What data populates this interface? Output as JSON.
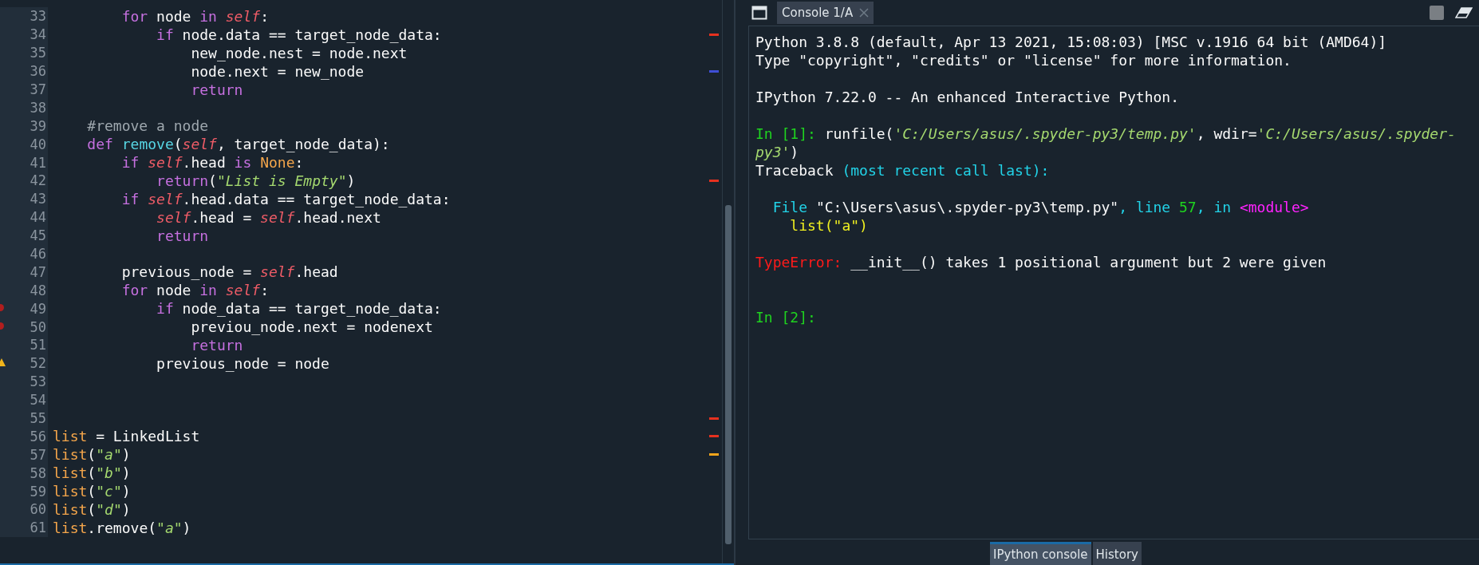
{
  "editor": {
    "lines": [
      {
        "number": "33",
        "overview_error": false,
        "overview_info": false,
        "overview_warning": false,
        "gutter_error": false,
        "gutter_warning": false,
        "tokens": [
          {
            "kind": "keyword",
            "text": "        for"
          },
          {
            "kind": "plain",
            "text": " node "
          },
          {
            "kind": "keyword",
            "text": "in "
          },
          {
            "kind": "self",
            "text": "self"
          },
          {
            "kind": "plain",
            "text": ":"
          }
        ]
      },
      {
        "number": "34",
        "overview_error": true,
        "overview_info": false,
        "overview_warning": false,
        "gutter_error": false,
        "gutter_warning": false,
        "tokens": [
          {
            "kind": "keyword",
            "text": "            if"
          },
          {
            "kind": "plain",
            "text": " node.data == target_node_data:"
          }
        ]
      },
      {
        "number": "35",
        "overview_error": false,
        "overview_info": false,
        "overview_warning": false,
        "gutter_error": false,
        "gutter_warning": false,
        "tokens": [
          {
            "kind": "plain",
            "text": "                new_node.nest = node.next"
          }
        ]
      },
      {
        "number": "36",
        "overview_error": false,
        "overview_info": true,
        "overview_warning": false,
        "gutter_error": false,
        "gutter_warning": false,
        "tokens": [
          {
            "kind": "plain",
            "text": "                node.next = new_node"
          }
        ]
      },
      {
        "number": "37",
        "overview_error": false,
        "overview_info": false,
        "overview_warning": false,
        "gutter_error": false,
        "gutter_warning": false,
        "tokens": [
          {
            "kind": "keyword",
            "text": "                return"
          }
        ]
      },
      {
        "number": "38",
        "overview_error": false,
        "overview_info": false,
        "overview_warning": false,
        "gutter_error": false,
        "gutter_warning": false
      },
      {
        "number": "39",
        "overview_error": false,
        "overview_info": false,
        "overview_warning": false,
        "gutter_error": false,
        "gutter_warning": false,
        "tokens": [
          {
            "kind": "comment",
            "text": "    #remove a node"
          }
        ]
      },
      {
        "number": "40",
        "overview_error": false,
        "overview_info": false,
        "overview_warning": false,
        "gutter_error": false,
        "gutter_warning": false,
        "tokens": [
          {
            "kind": "keyword",
            "text": "    def "
          },
          {
            "kind": "function",
            "text": "remove"
          },
          {
            "kind": "plain",
            "text": "("
          },
          {
            "kind": "self",
            "text": "self"
          },
          {
            "kind": "plain",
            "text": ", target_node_data):"
          }
        ]
      },
      {
        "number": "41",
        "overview_error": false,
        "overview_info": false,
        "overview_warning": false,
        "gutter_error": false,
        "gutter_warning": false,
        "tokens": [
          {
            "kind": "keyword",
            "text": "        if "
          },
          {
            "kind": "self",
            "text": "self"
          },
          {
            "kind": "plain",
            "text": ".head "
          },
          {
            "kind": "keyword",
            "text": "is "
          },
          {
            "kind": "builtin",
            "text": "None"
          },
          {
            "kind": "plain",
            "text": ":"
          }
        ]
      },
      {
        "number": "42",
        "overview_error": true,
        "overview_info": false,
        "overview_warning": false,
        "gutter_error": false,
        "gutter_warning": false,
        "tokens": [
          {
            "kind": "keyword",
            "text": "            return"
          },
          {
            "kind": "plain",
            "text": "("
          },
          {
            "kind": "string",
            "text": "\"List is Empty\""
          },
          {
            "kind": "plain",
            "text": ")"
          }
        ]
      },
      {
        "number": "43",
        "overview_error": false,
        "overview_info": false,
        "overview_warning": false,
        "gutter_error": false,
        "gutter_warning": false,
        "tokens": [
          {
            "kind": "keyword",
            "text": "        if "
          },
          {
            "kind": "self",
            "text": "self"
          },
          {
            "kind": "plain",
            "text": ".head.data == target_node_data:"
          }
        ]
      },
      {
        "number": "44",
        "overview_error": false,
        "overview_info": false,
        "overview_warning": false,
        "gutter_error": false,
        "gutter_warning": false,
        "tokens": [
          {
            "kind": "self",
            "text": "            self"
          },
          {
            "kind": "plain",
            "text": ".head = "
          },
          {
            "kind": "self",
            "text": "self"
          },
          {
            "kind": "plain",
            "text": ".head.next"
          }
        ]
      },
      {
        "number": "45",
        "overview_error": false,
        "overview_info": false,
        "overview_warning": false,
        "gutter_error": false,
        "gutter_warning": false,
        "tokens": [
          {
            "kind": "keyword",
            "text": "            return"
          }
        ]
      },
      {
        "number": "46",
        "overview_error": false,
        "overview_info": false,
        "overview_warning": false,
        "gutter_error": false,
        "gutter_warning": false
      },
      {
        "number": "47",
        "overview_error": false,
        "overview_info": false,
        "overview_warning": false,
        "gutter_error": false,
        "gutter_warning": false,
        "tokens": [
          {
            "kind": "plain",
            "text": "        previous_node = "
          },
          {
            "kind": "self",
            "text": "self"
          },
          {
            "kind": "plain",
            "text": ".head"
          }
        ]
      },
      {
        "number": "48",
        "overview_error": false,
        "overview_info": false,
        "overview_warning": false,
        "gutter_error": false,
        "gutter_warning": false,
        "tokens": [
          {
            "kind": "keyword",
            "text": "        for"
          },
          {
            "kind": "plain",
            "text": " node "
          },
          {
            "kind": "keyword",
            "text": "in "
          },
          {
            "kind": "self",
            "text": "self"
          },
          {
            "kind": "plain",
            "text": ":"
          }
        ]
      },
      {
        "number": "49",
        "overview_error": false,
        "overview_info": false,
        "overview_warning": false,
        "gutter_error": true,
        "gutter_warning": false,
        "tokens": [
          {
            "kind": "keyword",
            "text": "            if"
          },
          {
            "kind": "plain",
            "text": " node_data == target_node_data:"
          }
        ]
      },
      {
        "number": "50",
        "overview_error": false,
        "overview_info": false,
        "overview_warning": false,
        "gutter_error": true,
        "gutter_warning": false,
        "tokens": [
          {
            "kind": "plain",
            "text": "                previou_node.next = nodenext"
          }
        ]
      },
      {
        "number": "51",
        "overview_error": false,
        "overview_info": false,
        "overview_warning": false,
        "gutter_error": false,
        "gutter_warning": false,
        "tokens": [
          {
            "kind": "keyword",
            "text": "                return"
          }
        ]
      },
      {
        "number": "52",
        "overview_error": false,
        "overview_info": false,
        "overview_warning": false,
        "gutter_error": false,
        "gutter_warning": true,
        "tokens": [
          {
            "kind": "plain",
            "text": "            previous_node = node"
          }
        ]
      },
      {
        "number": "53",
        "overview_error": false,
        "overview_info": false,
        "overview_warning": false,
        "gutter_error": false,
        "gutter_warning": false
      },
      {
        "number": "54",
        "overview_error": false,
        "overview_info": false,
        "overview_warning": false,
        "gutter_error": false,
        "gutter_warning": false
      },
      {
        "number": "55",
        "overview_error": true,
        "overview_info": false,
        "overview_warning": false,
        "gutter_error": false,
        "gutter_warning": false
      },
      {
        "number": "56",
        "overview_error": true,
        "overview_info": false,
        "overview_warning": false,
        "gutter_error": false,
        "gutter_warning": false,
        "tokens": [
          {
            "kind": "builtin",
            "text": "list"
          },
          {
            "kind": "plain",
            "text": " = LinkedList"
          }
        ]
      },
      {
        "number": "57",
        "overview_error": false,
        "overview_info": false,
        "overview_warning": true,
        "gutter_error": false,
        "gutter_warning": false,
        "tokens": [
          {
            "kind": "builtin",
            "text": "list"
          },
          {
            "kind": "plain",
            "text": "("
          },
          {
            "kind": "string",
            "text": "\"a\""
          },
          {
            "kind": "plain",
            "text": ")"
          }
        ]
      },
      {
        "number": "58",
        "overview_error": false,
        "overview_info": false,
        "overview_warning": false,
        "gutter_error": false,
        "gutter_warning": false,
        "tokens": [
          {
            "kind": "builtin",
            "text": "list"
          },
          {
            "kind": "plain",
            "text": "("
          },
          {
            "kind": "string",
            "text": "\"b\""
          },
          {
            "kind": "plain",
            "text": ")"
          }
        ]
      },
      {
        "number": "59",
        "overview_error": false,
        "overview_info": false,
        "overview_warning": false,
        "gutter_error": false,
        "gutter_warning": false,
        "tokens": [
          {
            "kind": "builtin",
            "text": "list"
          },
          {
            "kind": "plain",
            "text": "("
          },
          {
            "kind": "string",
            "text": "\"c\""
          },
          {
            "kind": "plain",
            "text": ")"
          }
        ]
      },
      {
        "number": "60",
        "overview_error": false,
        "overview_info": false,
        "overview_warning": false,
        "gutter_error": false,
        "gutter_warning": false,
        "tokens": [
          {
            "kind": "builtin",
            "text": "list"
          },
          {
            "kind": "plain",
            "text": "("
          },
          {
            "kind": "string",
            "text": "\"d\""
          },
          {
            "kind": "plain",
            "text": ")"
          }
        ]
      },
      {
        "number": "61",
        "overview_error": false,
        "overview_info": false,
        "overview_warning": false,
        "gutter_error": false,
        "gutter_warning": false,
        "tokens": [
          {
            "kind": "builtin",
            "text": "list"
          },
          {
            "kind": "plain",
            "text": ".remove("
          },
          {
            "kind": "string",
            "text": "\"a\""
          },
          {
            "kind": "plain",
            "text": ")"
          }
        ]
      }
    ]
  },
  "console": {
    "tabs": [
      {
        "label": "Console 1/A",
        "selected": true
      }
    ],
    "lines": [
      {
        "kind": "text",
        "segments": [
          {
            "kind": "plain",
            "text": "Python 3.8.8 (default, Apr 13 2021, 15:08:03) [MSC v.1916 64 bit (AMD64)]"
          }
        ]
      },
      {
        "kind": "text",
        "segments": [
          {
            "kind": "plain",
            "text": "Type \"copyright\", \"credits\" or \"license\" for more information."
          }
        ]
      },
      {
        "kind": "blank"
      },
      {
        "kind": "text",
        "segments": [
          {
            "kind": "plain",
            "text": "IPython 7.22.0 -- An enhanced Interactive Python."
          }
        ]
      },
      {
        "kind": "blank"
      },
      {
        "kind": "text",
        "segments": [
          {
            "kind": "prompt",
            "text": "In [1]:"
          },
          {
            "kind": "plain",
            "text": " runfile("
          },
          {
            "kind": "string",
            "text": "'C:/Users/asus/.spyder-py3/temp.py'"
          },
          {
            "kind": "plain",
            "text": ", wdir="
          },
          {
            "kind": "string",
            "text": "'C:/Users/asus/.spyder-py3'"
          },
          {
            "kind": "plain",
            "text": ")"
          }
        ]
      },
      {
        "kind": "text",
        "segments": [
          {
            "kind": "plain",
            "text": "Traceback "
          },
          {
            "kind": "cyan",
            "text": "(most recent call last):"
          }
        ]
      },
      {
        "kind": "blank"
      },
      {
        "kind": "text",
        "segments": [
          {
            "kind": "cyan",
            "text": "  File "
          },
          {
            "kind": "plain",
            "text": "\"C:\\Users\\asus\\.spyder-py3\\temp.py\""
          },
          {
            "kind": "cyan",
            "text": ", line "
          },
          {
            "kind": "number",
            "text": "57"
          },
          {
            "kind": "cyan",
            "text": ", in "
          },
          {
            "kind": "magenta",
            "text": "<module>"
          }
        ]
      },
      {
        "kind": "text",
        "segments": [
          {
            "kind": "yellow",
            "text": "    list(\"a\")"
          }
        ]
      },
      {
        "kind": "blank"
      },
      {
        "kind": "text",
        "segments": [
          {
            "kind": "error",
            "text": "TypeError:"
          },
          {
            "kind": "plain",
            "text": " __init__() takes 1 positional argument but 2 were given"
          }
        ]
      },
      {
        "kind": "blank"
      },
      {
        "kind": "blank"
      },
      {
        "kind": "text",
        "segments": [
          {
            "kind": "prompt",
            "text": "In [2]:"
          }
        ]
      }
    ]
  },
  "bottom_tabs": [
    {
      "label": "IPython console",
      "selected": true
    },
    {
      "label": "History",
      "selected": false
    }
  ]
}
